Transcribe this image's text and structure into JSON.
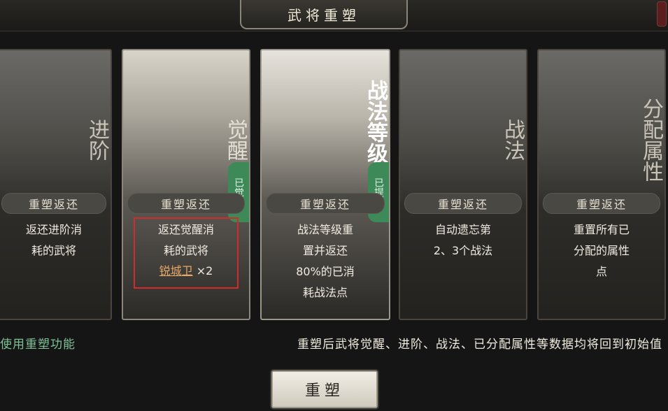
{
  "header": {
    "title": "武将重塑"
  },
  "cards": [
    {
      "title": "进阶",
      "return_label": "重塑返还",
      "description": "返还进阶消\n耗的武将"
    },
    {
      "title": "觉醒",
      "badge": "已觉醒",
      "return_label": "重塑返还",
      "description": "返还觉醒消\n耗的武将",
      "cost_item": "锐城卫",
      "cost_qty": "×2"
    },
    {
      "title": "战法等级",
      "badge": "已提升",
      "return_label": "重塑返还",
      "description": "战法等级重\n置并返还\n80%的已消\n耗战法点"
    },
    {
      "title": "战法",
      "return_label": "重塑返还",
      "description": "自动遗忘第\n2、3个战法"
    },
    {
      "title": "分配属性",
      "return_label": "重塑返还",
      "description": "重置所有已\n分配的属性\n点"
    }
  ],
  "footer": {
    "left_text": "使用重塑功能",
    "right_text": "重塑后武将觉醒、进阶、战法、已分配属性等数据均将回到初始值"
  },
  "actions": {
    "reset_label": "重塑"
  }
}
